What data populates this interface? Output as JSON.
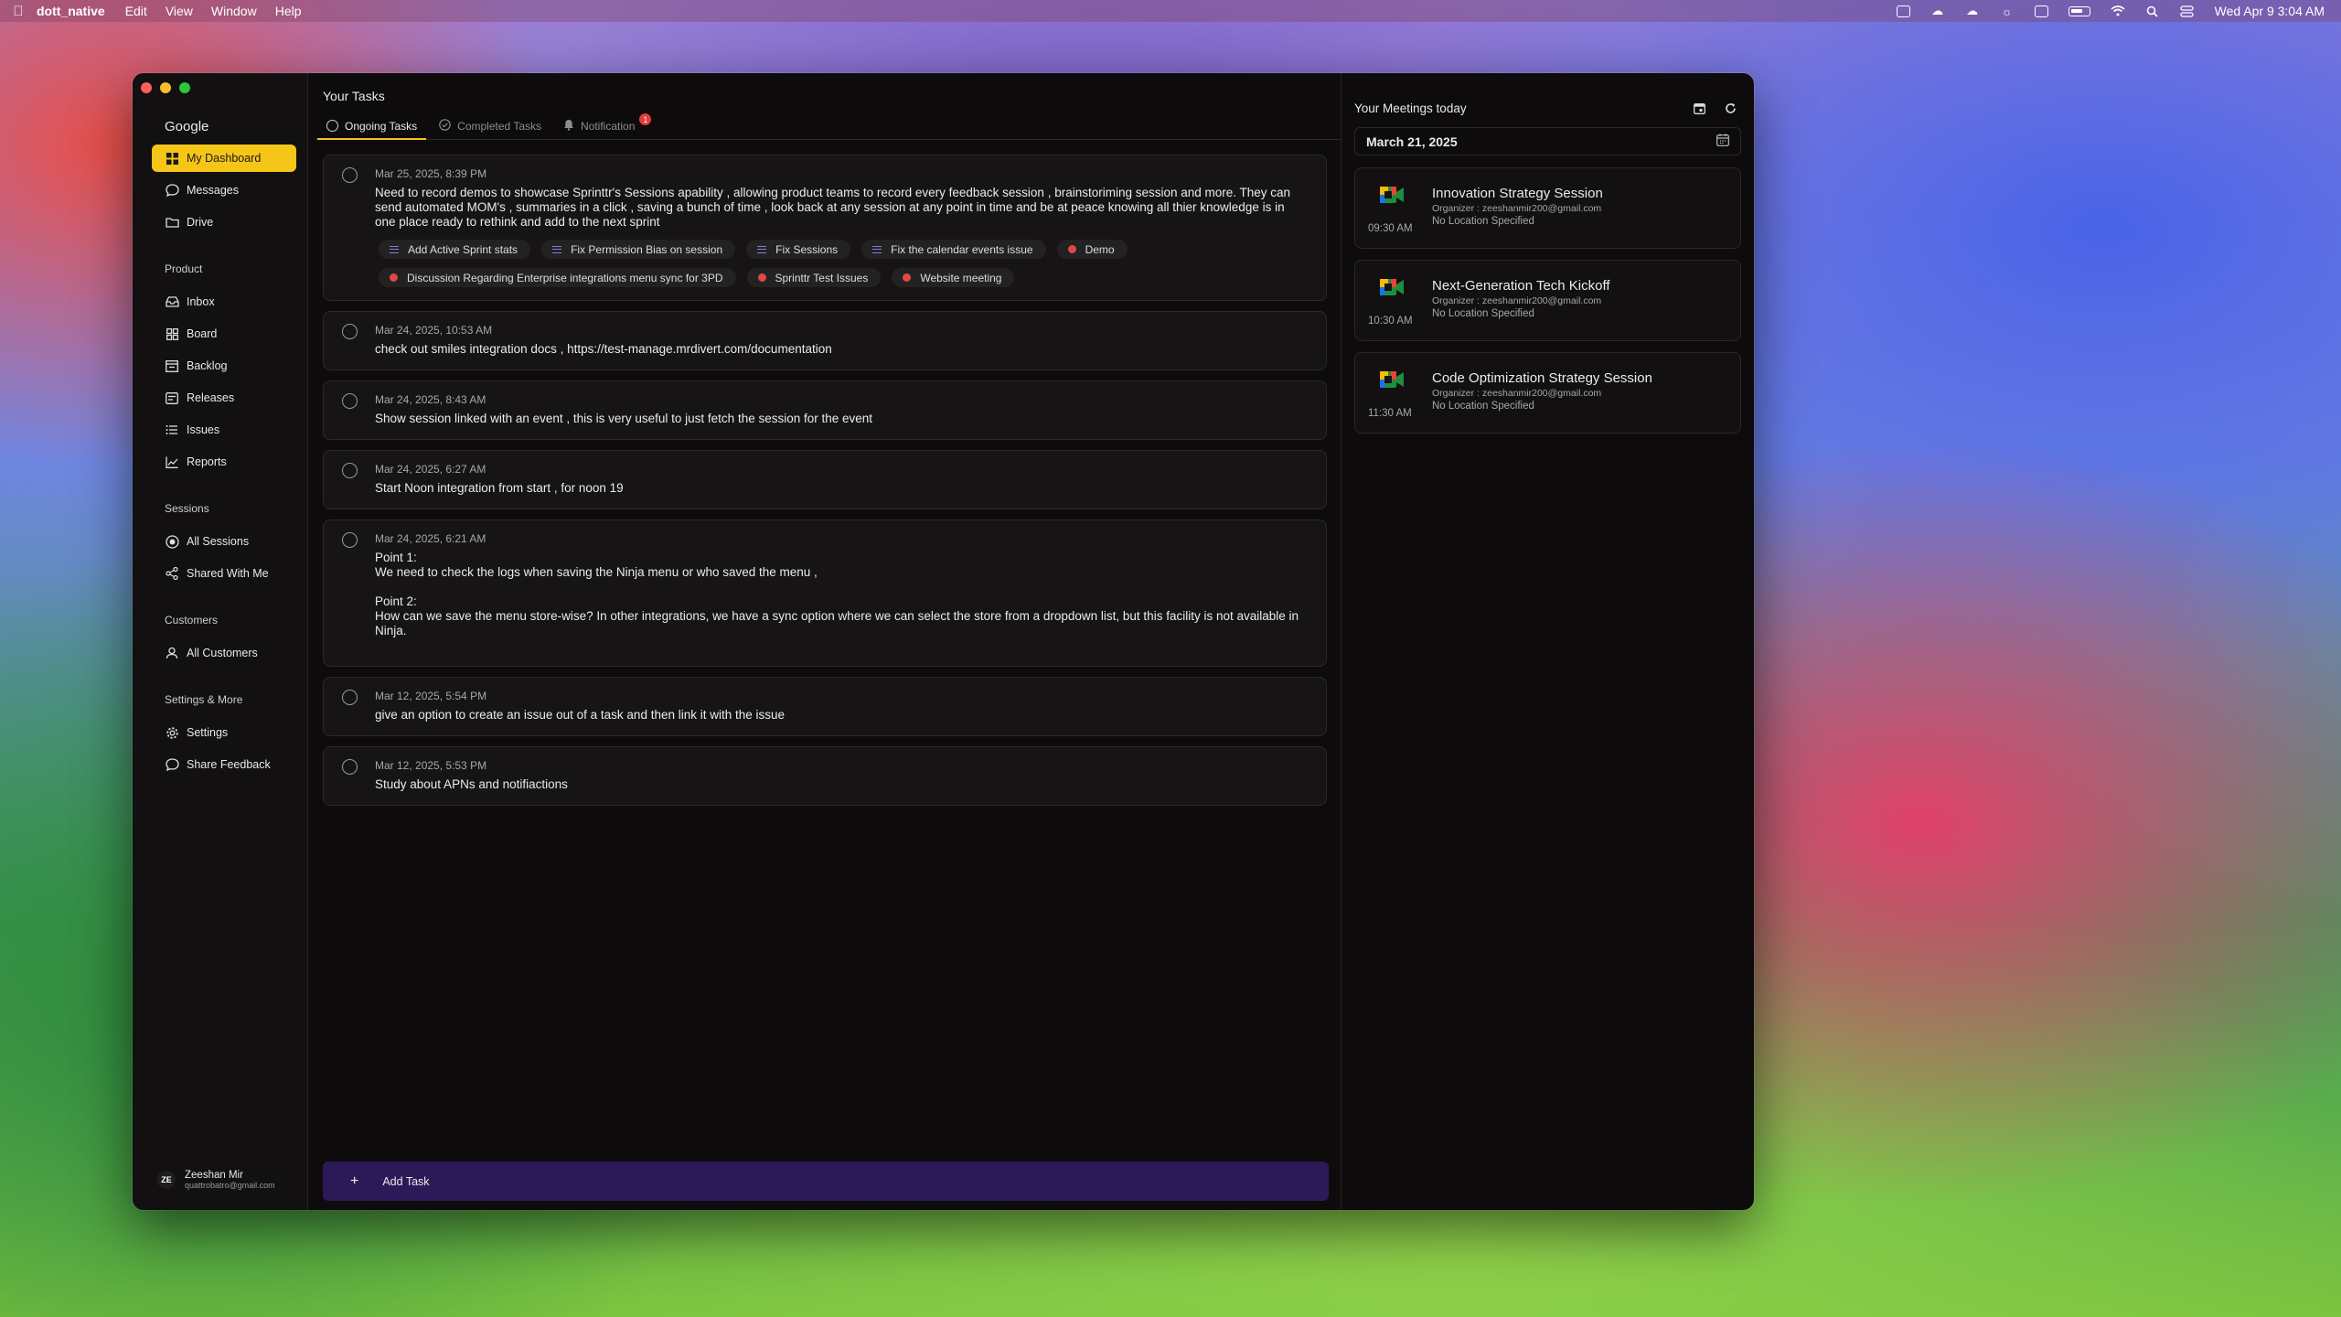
{
  "menubar": {
    "app_name": "dott_native",
    "items": [
      "Edit",
      "View",
      "Window",
      "Help"
    ],
    "clock": "Wed Apr 9  3:04 AM"
  },
  "sidebar": {
    "workspace": "Google",
    "top_items": [
      {
        "label": "My Dashboard",
        "icon": "dashboard-icon",
        "active": true
      },
      {
        "label": "Messages",
        "icon": "chat-icon"
      },
      {
        "label": "Drive",
        "icon": "folder-icon"
      }
    ],
    "sections": [
      {
        "title": "Product",
        "items": [
          {
            "label": "Inbox",
            "icon": "inbox-icon"
          },
          {
            "label": "Board",
            "icon": "board-icon"
          },
          {
            "label": "Backlog",
            "icon": "backlog-icon"
          },
          {
            "label": "Releases",
            "icon": "releases-icon"
          },
          {
            "label": "Issues",
            "icon": "list-icon"
          },
          {
            "label": "Reports",
            "icon": "chart-icon"
          }
        ]
      },
      {
        "title": "Sessions",
        "items": [
          {
            "label": "All Sessions",
            "icon": "record-icon"
          },
          {
            "label": "Shared With Me",
            "icon": "share-icon"
          }
        ]
      },
      {
        "title": "Customers",
        "items": [
          {
            "label": "All Customers",
            "icon": "user-icon"
          }
        ]
      },
      {
        "title": "Settings & More",
        "items": [
          {
            "label": "Settings",
            "icon": "gear-icon"
          },
          {
            "label": "Share Feedback",
            "icon": "chat-icon"
          }
        ]
      }
    ],
    "profile": {
      "initials": "ZE",
      "name": "Zeeshan Mir",
      "email": "quattrobatro@gmail.com"
    }
  },
  "tasks": {
    "title": "Your Tasks",
    "tabs": [
      {
        "label": "Ongoing Tasks",
        "active": true
      },
      {
        "label": "Completed Tasks"
      },
      {
        "label": "Notification",
        "badge": "1"
      }
    ],
    "items": [
      {
        "date": "Mar 25, 2025, 8:39 PM",
        "text": "Need to record demos to showcase Sprinttr's Sessions apability , allowing product teams to record every feedback session , brainstoriming session and more. They can send automated MOM's , summaries in a click , saving a bunch of time , look back at any session at any point in time and be at peace knowing all thier knowledge is in one place ready to rethink and add to the next sprint",
        "chips": [
          {
            "label": "Add Active Sprint stats",
            "kind": "list"
          },
          {
            "label": "Fix Permission Bias on session",
            "kind": "list"
          },
          {
            "label": "Fix Sessions",
            "kind": "list"
          },
          {
            "label": "Fix the calendar events issue",
            "kind": "list"
          },
          {
            "label": "Demo",
            "kind": "dot"
          },
          {
            "label": "Discussion Regarding Enterprise integrations menu sync for 3PD",
            "kind": "dot"
          },
          {
            "label": "Sprinttr Test Issues",
            "kind": "dot"
          },
          {
            "label": "Website meeting",
            "kind": "dot"
          }
        ]
      },
      {
        "date": "Mar 24, 2025, 10:53 AM",
        "text": "check out smiles integration docs , https://test-manage.mrdivert.com/documentation"
      },
      {
        "date": "Mar 24, 2025, 8:43 AM",
        "text": "Show session linked with an event , this is very useful to just fetch the session for the event"
      },
      {
        "date": "Mar 24, 2025, 6:27 AM",
        "text": "Start Noon integration from start , for noon 19"
      },
      {
        "date": "Mar 24, 2025, 6:21 AM",
        "text": "Point 1:\nWe need to check the logs when saving the Ninja menu or who saved the menu ,\n\nPoint 2:\nHow can we save the menu store-wise? In other integrations, we have a sync option where we can select the store from a dropdown list, but this facility is not available in Ninja.\n "
      },
      {
        "date": "Mar 12, 2025, 5:54 PM",
        "text": "give an option to create an issue out of a task and then link it with the issue"
      },
      {
        "date": "Mar 12, 2025, 5:53 PM",
        "text": "Study about APNs and notifiactions"
      }
    ],
    "add_label": "Add Task"
  },
  "meetings": {
    "title": "Your Meetings today",
    "date": "March 21, 2025",
    "items": [
      {
        "title": "Innovation Strategy Session",
        "organizer": "Organizer : zeeshanmir200@gmail.com",
        "location": "No Location Specified",
        "time": "09:30 AM"
      },
      {
        "title": "Next-Generation Tech Kickoff",
        "organizer": "Organizer : zeeshanmir200@gmail.com",
        "location": "No Location Specified",
        "time": "10:30 AM"
      },
      {
        "title": "Code Optimization Strategy Session",
        "organizer": "Organizer : zeeshanmir200@gmail.com",
        "location": "No Location Specified",
        "time": "11:30 AM"
      }
    ]
  },
  "colors": {
    "accent": "#f5c518",
    "add_task_bg": "#2c1a58",
    "badge": "#e23b3b",
    "chip_list": "#7f7fd9",
    "chip_dot": "#e04848"
  }
}
